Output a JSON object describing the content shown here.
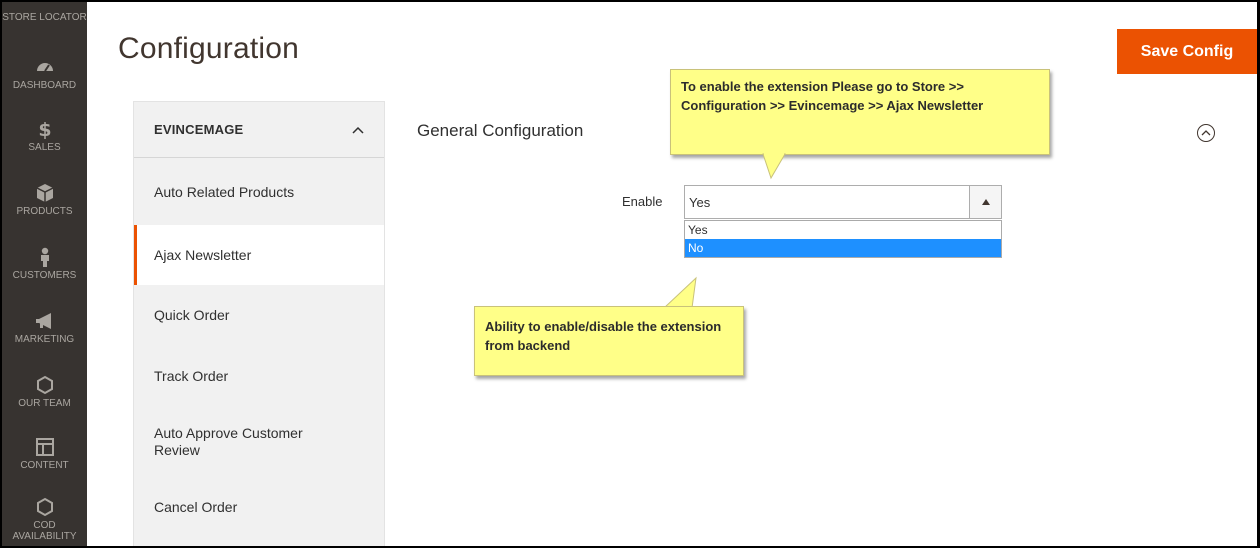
{
  "nav": {
    "items": [
      {
        "label": "STORE LOCATOR",
        "icon": "store-locator-icon"
      },
      {
        "label": "DASHBOARD",
        "icon": "dashboard-icon"
      },
      {
        "label": "SALES",
        "icon": "dollar-icon"
      },
      {
        "label": "PRODUCTS",
        "icon": "box-icon"
      },
      {
        "label": "CUSTOMERS",
        "icon": "person-icon"
      },
      {
        "label": "MARKETING",
        "icon": "megaphone-icon"
      },
      {
        "label": "OUR TEAM",
        "icon": "hexagon-icon"
      },
      {
        "label": "CONTENT",
        "icon": "content-layout-icon"
      },
      {
        "label": "COD AVAILABILITY",
        "icon": "hexagon-icon"
      }
    ]
  },
  "header": {
    "title": "Configuration",
    "save_label": "Save Config"
  },
  "config_sidebar": {
    "group_label": "EVINCEMAGE",
    "items": [
      {
        "label": "Auto Related Products"
      },
      {
        "label": "Ajax Newsletter"
      },
      {
        "label": "Quick Order"
      },
      {
        "label": "Track Order"
      },
      {
        "label": "Auto Approve Customer Review"
      },
      {
        "label": "Cancel Order"
      }
    ]
  },
  "main": {
    "section_title": "General Configuration",
    "field_label": "Enable",
    "select_value": "Yes",
    "options": [
      "Yes",
      "No"
    ],
    "highlighted_option": "No"
  },
  "callouts": {
    "top": "To enable the extension Please go to Store >> Configuration >> Evincemage >> Ajax Newsletter",
    "bottom": "Ability to enable/disable the extension from backend"
  },
  "colors": {
    "accent": "#eb5202",
    "nav_bg": "#373330",
    "callout_bg": "#ffff88",
    "option_highlight": "#1e90ff"
  }
}
